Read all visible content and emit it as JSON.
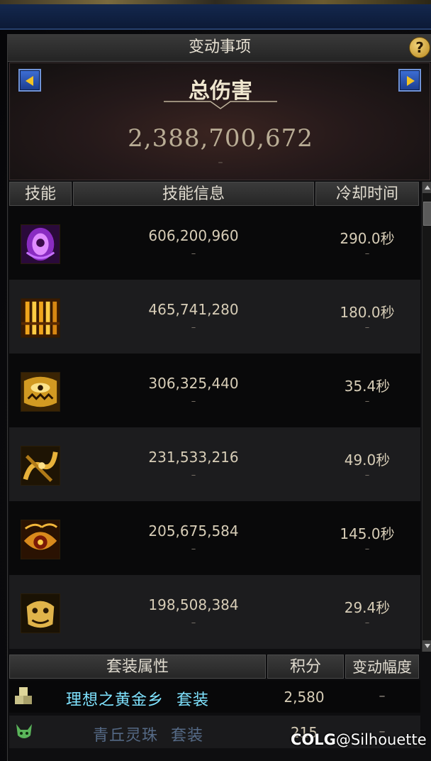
{
  "window": {
    "title": "变动事项",
    "help_symbol": "?"
  },
  "summary": {
    "label": "总伤害",
    "value": "2,388,700,672",
    "change": "–"
  },
  "table": {
    "headers": [
      "技能",
      "技能信息",
      "冷却时间"
    ],
    "rows": [
      {
        "icon": "purple-eye-skill-icon",
        "damage": "606,200,960",
        "damage_change": "–",
        "cooldown": "290.0秒",
        "cooldown_change": "–"
      },
      {
        "icon": "golden-pillars-skill-icon",
        "damage": "465,741,280",
        "damage_change": "–",
        "cooldown": "180.0秒",
        "cooldown_change": "–"
      },
      {
        "icon": "golden-monster-skill-icon",
        "damage": "306,325,440",
        "damage_change": "–",
        "cooldown": "35.4秒",
        "cooldown_change": "–"
      },
      {
        "icon": "golden-tentacle-skill-icon",
        "damage": "231,533,216",
        "damage_change": "–",
        "cooldown": "49.0秒",
        "cooldown_change": "–"
      },
      {
        "icon": "golden-eye-skill-icon",
        "damage": "205,675,584",
        "damage_change": "–",
        "cooldown": "145.0秒",
        "cooldown_change": "–"
      },
      {
        "icon": "golden-mask-skill-icon",
        "damage": "198,508,384",
        "damage_change": "–",
        "cooldown": "29.4秒",
        "cooldown_change": "–"
      }
    ]
  },
  "sets": {
    "headers": [
      "套装属性",
      "积分",
      "变动幅度"
    ],
    "rows": [
      {
        "icon": "golden-cubes-set-icon",
        "name": "理想之黄金乡",
        "suffix": "套装",
        "score": "2,580",
        "change": "–",
        "name_color": "#7fe3ff"
      },
      {
        "icon": "fox-set-icon",
        "name": "青丘灵珠",
        "suffix": "套装",
        "score": "215",
        "change": "–",
        "name_color": "#556a86"
      }
    ]
  },
  "watermark": {
    "brand": "COLG",
    "handle": "@Silhouette"
  },
  "colors": {
    "accent_gold": "#f3c323",
    "arrow_blue": "#2b57b8",
    "header_text": "#e0dbcf",
    "value_text": "#d7cdb7"
  }
}
